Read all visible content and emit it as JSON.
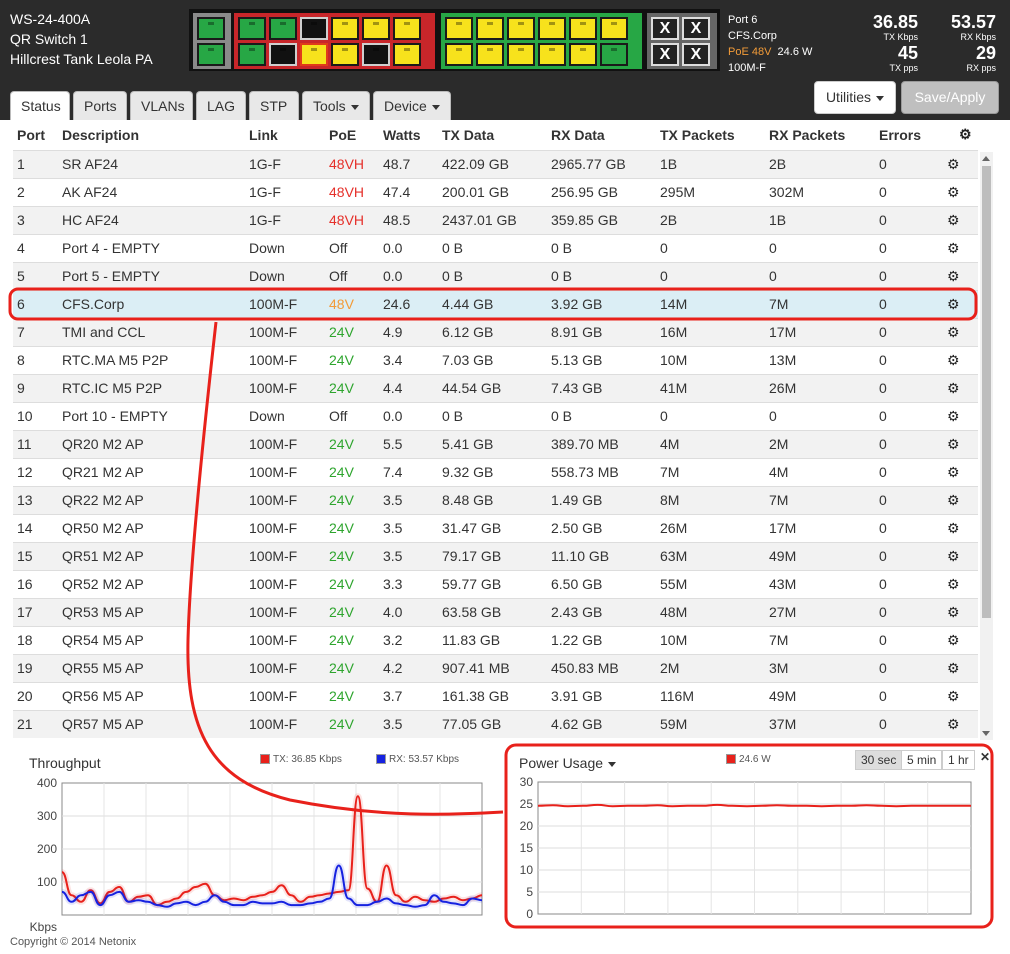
{
  "device": {
    "model": "WS-24-400A",
    "name": "QR Switch 1",
    "location": "Hillcrest Tank Leola PA"
  },
  "port_map": {
    "groupA": [
      [
        "green"
      ],
      [
        "green"
      ]
    ],
    "groupB": [
      [
        "green",
        "green",
        "black",
        "yellow",
        "yellow",
        "yellow"
      ],
      [
        "green",
        "black",
        "selected",
        "yellow",
        "black",
        "yellow"
      ]
    ],
    "groupC": [
      [
        "yellow",
        "yellow",
        "yellow",
        "yellow",
        "yellow",
        "yellow"
      ],
      [
        "yellow",
        "yellow",
        "yellow",
        "yellow",
        "yellow",
        "green"
      ]
    ],
    "groupD_symbol": "X"
  },
  "port_detail": {
    "port": "Port 6",
    "desc": "CFS.Corp",
    "poe": "PoE 48V",
    "watts": "24.6 W",
    "link": "100M-F"
  },
  "stats": {
    "tx_kbps": "36.85",
    "tx_kbps_label": "TX Kbps",
    "rx_kbps": "53.57",
    "rx_kbps_label": "RX Kbps",
    "tx_pps": "45",
    "tx_pps_label": "TX pps",
    "rx_pps": "29",
    "rx_pps_label": "RX pps"
  },
  "tabs": {
    "status": "Status",
    "ports": "Ports",
    "vlans": "VLANs",
    "lag": "LAG",
    "stp": "STP",
    "tools": "Tools",
    "device": "Device"
  },
  "buttons": {
    "utilities": "Utilities",
    "save": "Save/Apply"
  },
  "table": {
    "headers": {
      "port": "Port",
      "desc": "Description",
      "link": "Link",
      "poe": "PoE",
      "watts": "Watts",
      "tx": "TX Data",
      "rx": "RX Data",
      "txp": "TX Packets",
      "rxp": "RX Packets",
      "err": "Errors"
    },
    "rows": [
      [
        "1",
        "SR AF24",
        "1G-F",
        "48VH",
        "48.7",
        "422.09 GB",
        "2965.77 GB",
        "1B",
        "2B",
        "0"
      ],
      [
        "2",
        "AK AF24",
        "1G-F",
        "48VH",
        "47.4",
        "200.01 GB",
        "256.95 GB",
        "295M",
        "302M",
        "0"
      ],
      [
        "3",
        "HC AF24",
        "1G-F",
        "48VH",
        "48.5",
        "2437.01 GB",
        "359.85 GB",
        "2B",
        "1B",
        "0"
      ],
      [
        "4",
        "Port 4 - EMPTY",
        "Down",
        "Off",
        "0.0",
        "0 B",
        "0 B",
        "0",
        "0",
        "0"
      ],
      [
        "5",
        "Port 5 - EMPTY",
        "Down",
        "Off",
        "0.0",
        "0 B",
        "0 B",
        "0",
        "0",
        "0"
      ],
      [
        "6",
        "CFS.Corp",
        "100M-F",
        "48V",
        "24.6",
        "4.44 GB",
        "3.92 GB",
        "14M",
        "7M",
        "0"
      ],
      [
        "7",
        "TMI and CCL",
        "100M-F",
        "24V",
        "4.9",
        "6.12 GB",
        "8.91 GB",
        "16M",
        "17M",
        "0"
      ],
      [
        "8",
        "RTC.MA M5 P2P",
        "100M-F",
        "24V",
        "3.4",
        "7.03 GB",
        "5.13 GB",
        "10M",
        "13M",
        "0"
      ],
      [
        "9",
        "RTC.IC M5 P2P",
        "100M-F",
        "24V",
        "4.4",
        "44.54 GB",
        "7.43 GB",
        "41M",
        "26M",
        "0"
      ],
      [
        "10",
        "Port 10 - EMPTY",
        "Down",
        "Off",
        "0.0",
        "0 B",
        "0 B",
        "0",
        "0",
        "0"
      ],
      [
        "11",
        "QR20 M2 AP",
        "100M-F",
        "24V",
        "5.5",
        "5.41 GB",
        "389.70 MB",
        "4M",
        "2M",
        "0"
      ],
      [
        "12",
        "QR21 M2 AP",
        "100M-F",
        "24V",
        "7.4",
        "9.32 GB",
        "558.73 MB",
        "7M",
        "4M",
        "0"
      ],
      [
        "13",
        "QR22 M2 AP",
        "100M-F",
        "24V",
        "3.5",
        "8.48 GB",
        "1.49 GB",
        "8M",
        "7M",
        "0"
      ],
      [
        "14",
        "QR50 M2 AP",
        "100M-F",
        "24V",
        "3.5",
        "31.47 GB",
        "2.50 GB",
        "26M",
        "17M",
        "0"
      ],
      [
        "15",
        "QR51 M2 AP",
        "100M-F",
        "24V",
        "3.5",
        "79.17 GB",
        "11.10 GB",
        "63M",
        "49M",
        "0"
      ],
      [
        "16",
        "QR52 M2 AP",
        "100M-F",
        "24V",
        "3.3",
        "59.77 GB",
        "6.50 GB",
        "55M",
        "43M",
        "0"
      ],
      [
        "17",
        "QR53 M5 AP",
        "100M-F",
        "24V",
        "4.0",
        "63.58 GB",
        "2.43 GB",
        "48M",
        "27M",
        "0"
      ],
      [
        "18",
        "QR54 M5 AP",
        "100M-F",
        "24V",
        "3.2",
        "11.83 GB",
        "1.22 GB",
        "10M",
        "7M",
        "0"
      ],
      [
        "19",
        "QR55 M5 AP",
        "100M-F",
        "24V",
        "4.2",
        "907.41 MB",
        "450.83 MB",
        "2M",
        "3M",
        "0"
      ],
      [
        "20",
        "QR56 M5 AP",
        "100M-F",
        "24V",
        "3.7",
        "161.38 GB",
        "3.91 GB",
        "116M",
        "49M",
        "0"
      ],
      [
        "21",
        "QR57 M5 AP",
        "100M-F",
        "24V",
        "3.5",
        "77.05 GB",
        "4.62 GB",
        "59M",
        "37M",
        "0"
      ]
    ],
    "selected_row": "6"
  },
  "throughput": {
    "title": "Throughput",
    "tx_legend": "TX: 36.85 Kbps",
    "rx_legend": "RX: 53.57 Kbps",
    "y_unit": "Kbps",
    "y_ticks": [
      "400",
      "300",
      "200",
      "100"
    ],
    "tx_color": "#e8211b",
    "rx_color": "#1622e0"
  },
  "power": {
    "title": "Power Usage",
    "legend": "24.6 W",
    "y_ticks": [
      "30",
      "25",
      "20",
      "15",
      "10",
      "5",
      "0"
    ],
    "ranges": [
      "30 sec",
      "5 min",
      "1 hr"
    ],
    "active_range": "30 sec",
    "color": "#e8211b"
  },
  "chart_data": [
    {
      "type": "line",
      "title": "Throughput",
      "ylabel": "Kbps",
      "ylim": [
        0,
        400
      ],
      "series": [
        {
          "name": "TX: 36.85 Kbps",
          "values": [
            130,
            60,
            40,
            75,
            35,
            70,
            85,
            40,
            55,
            60,
            30,
            40,
            50,
            70,
            85,
            95,
            60,
            45,
            50,
            45,
            55,
            60,
            70,
            90,
            60,
            40,
            55,
            60,
            65,
            70,
            75,
            360,
            80,
            40,
            150,
            60,
            40,
            55,
            45,
            40,
            50,
            55,
            45,
            50,
            60
          ]
        },
        {
          "name": "RX: 53.57 Kbps",
          "values": [
            70,
            40,
            60,
            70,
            30,
            60,
            70,
            40,
            45,
            40,
            30,
            25,
            35,
            40,
            30,
            40,
            60,
            40,
            30,
            30,
            40,
            35,
            35,
            40,
            30,
            30,
            35,
            40,
            50,
            150,
            50,
            30,
            30,
            40,
            50,
            35,
            30,
            25,
            30,
            60,
            40,
            35,
            30,
            50,
            45
          ]
        }
      ]
    },
    {
      "type": "line",
      "title": "Power Usage",
      "ylim": [
        0,
        30
      ],
      "series": [
        {
          "name": "24.6 W",
          "values": [
            24.6,
            24.7,
            24.5,
            24.6,
            24.8,
            24.5,
            24.6,
            24.6,
            24.7,
            24.5,
            24.6,
            24.6,
            24.8,
            24.6,
            24.5,
            24.6,
            24.7,
            24.6,
            24.6,
            24.5,
            24.6,
            24.6,
            24.7,
            24.6,
            24.5,
            24.6,
            24.6,
            24.6,
            24.6,
            24.6
          ]
        }
      ]
    }
  ],
  "annotation_color": "#e8211b",
  "copyright": "Copyright © 2014 Netonix"
}
